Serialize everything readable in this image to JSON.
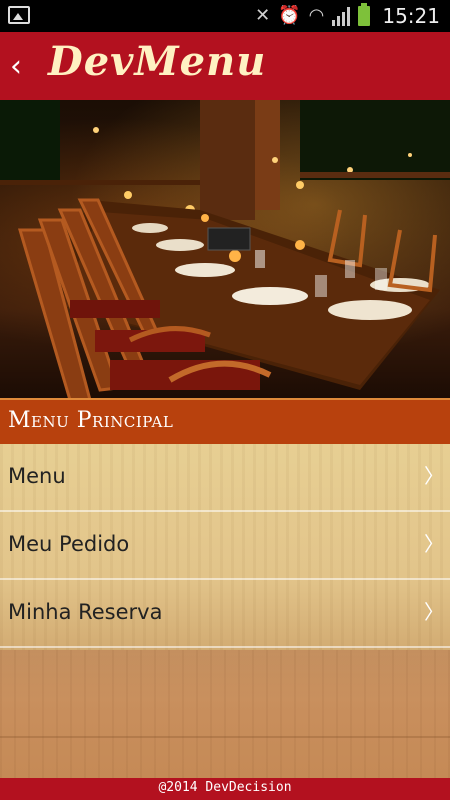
{
  "status_bar": {
    "time": "15:21",
    "icons": [
      "image-icon",
      "mute-icon",
      "alarm-icon",
      "wifi-icon",
      "signal-icon",
      "battery-icon"
    ]
  },
  "app_bar": {
    "title": "DevMenu",
    "back_icon": "chevron-left-icon"
  },
  "section": {
    "title": "Menu Principal"
  },
  "menu_items": [
    {
      "label": "Menu",
      "icon": "chevron-right-icon"
    },
    {
      "label": "Meu Pedido",
      "icon": "chevron-right-icon"
    },
    {
      "label": "Minha Reserva",
      "icon": "chevron-right-icon"
    }
  ],
  "footer": {
    "text": "@2014 DevDecision"
  },
  "colors": {
    "app_bar": "#b3111f",
    "title_text": "#fff1c2",
    "section_header": "#b8410d",
    "footer": "#b3111f"
  }
}
